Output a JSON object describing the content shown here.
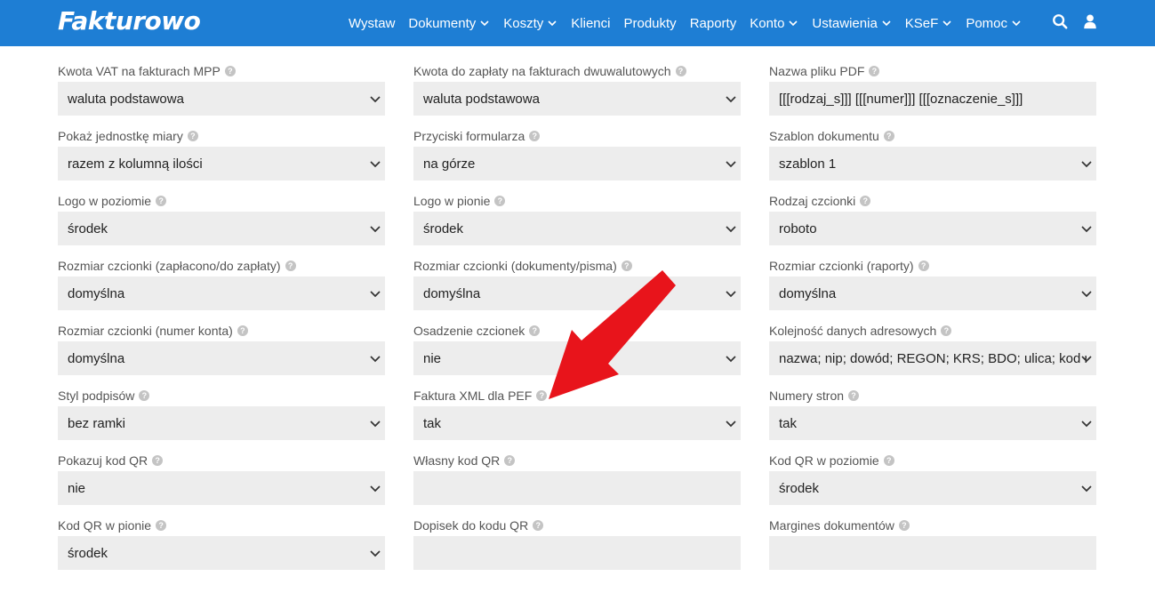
{
  "header": {
    "logo": "Fakturowo",
    "menu": [
      {
        "label": "Wystaw",
        "dropdown": false
      },
      {
        "label": "Dokumenty",
        "dropdown": true
      },
      {
        "label": "Koszty",
        "dropdown": true
      },
      {
        "label": "Klienci",
        "dropdown": false
      },
      {
        "label": "Produkty",
        "dropdown": false
      },
      {
        "label": "Raporty",
        "dropdown": false
      },
      {
        "label": "Konto",
        "dropdown": true
      },
      {
        "label": "Ustawienia",
        "dropdown": true
      },
      {
        "label": "KSeF",
        "dropdown": true
      },
      {
        "label": "Pomoc",
        "dropdown": true
      }
    ],
    "icons": [
      "search-icon",
      "user-icon"
    ]
  },
  "colors": {
    "navbar": "#1e7ed4",
    "field_bg": "#ededed",
    "annotation_arrow": "#e8141b"
  },
  "fields": [
    {
      "label": "Kwota VAT na fakturach MPP",
      "type": "select",
      "value": "waluta podstawowa"
    },
    {
      "label": "Kwota do zapłaty na fakturach dwuwalutowych",
      "type": "select",
      "value": "waluta podstawowa"
    },
    {
      "label": "Nazwa pliku PDF",
      "type": "input",
      "value": "[[[rodzaj_s]]] [[[numer]]] [[[oznaczenie_s]]]"
    },
    {
      "label": "Pokaż jednostkę miary",
      "type": "select",
      "value": "razem z kolumną ilości"
    },
    {
      "label": "Przyciski formularza",
      "type": "select",
      "value": "na górze"
    },
    {
      "label": "Szablon dokumentu",
      "type": "select",
      "value": "szablon 1"
    },
    {
      "label": "Logo w poziomie",
      "type": "select",
      "value": "środek"
    },
    {
      "label": "Logo w pionie",
      "type": "select",
      "value": "środek"
    },
    {
      "label": "Rodzaj czcionki",
      "type": "select",
      "value": "roboto"
    },
    {
      "label": "Rozmiar czcionki (zapłacono/do zapłaty)",
      "type": "select",
      "value": "domyślna"
    },
    {
      "label": "Rozmiar czcionki (dokumenty/pisma)",
      "type": "select",
      "value": "domyślna"
    },
    {
      "label": "Rozmiar czcionki (raporty)",
      "type": "select",
      "value": "domyślna"
    },
    {
      "label": "Rozmiar czcionki (numer konta)",
      "type": "select",
      "value": "domyślna"
    },
    {
      "label": "Osadzenie czcionek",
      "type": "select",
      "value": "nie"
    },
    {
      "label": "Kolejność danych adresowych",
      "type": "select",
      "value": "nazwa; nip; dowód; REGON; KRS; BDO; ulica; kod miasto"
    },
    {
      "label": "Styl podpisów",
      "type": "select",
      "value": "bez ramki"
    },
    {
      "label": "Faktura XML dla PEF",
      "type": "select",
      "value": "tak"
    },
    {
      "label": "Numery stron",
      "type": "select",
      "value": "tak"
    },
    {
      "label": "Pokazuj kod QR",
      "type": "select",
      "value": "nie"
    },
    {
      "label": "Własny kod QR",
      "type": "input",
      "value": ""
    },
    {
      "label": "Kod QR w poziomie",
      "type": "select",
      "value": "środek"
    },
    {
      "label": "Kod QR w pionie",
      "type": "select",
      "value": "środek"
    },
    {
      "label": "Dopisek do kodu QR",
      "type": "input",
      "value": ""
    },
    {
      "label": "Margines dokumentów",
      "type": "input",
      "value": ""
    }
  ],
  "annotation": {
    "type": "arrow",
    "points_to": "Faktura XML dla PEF"
  }
}
